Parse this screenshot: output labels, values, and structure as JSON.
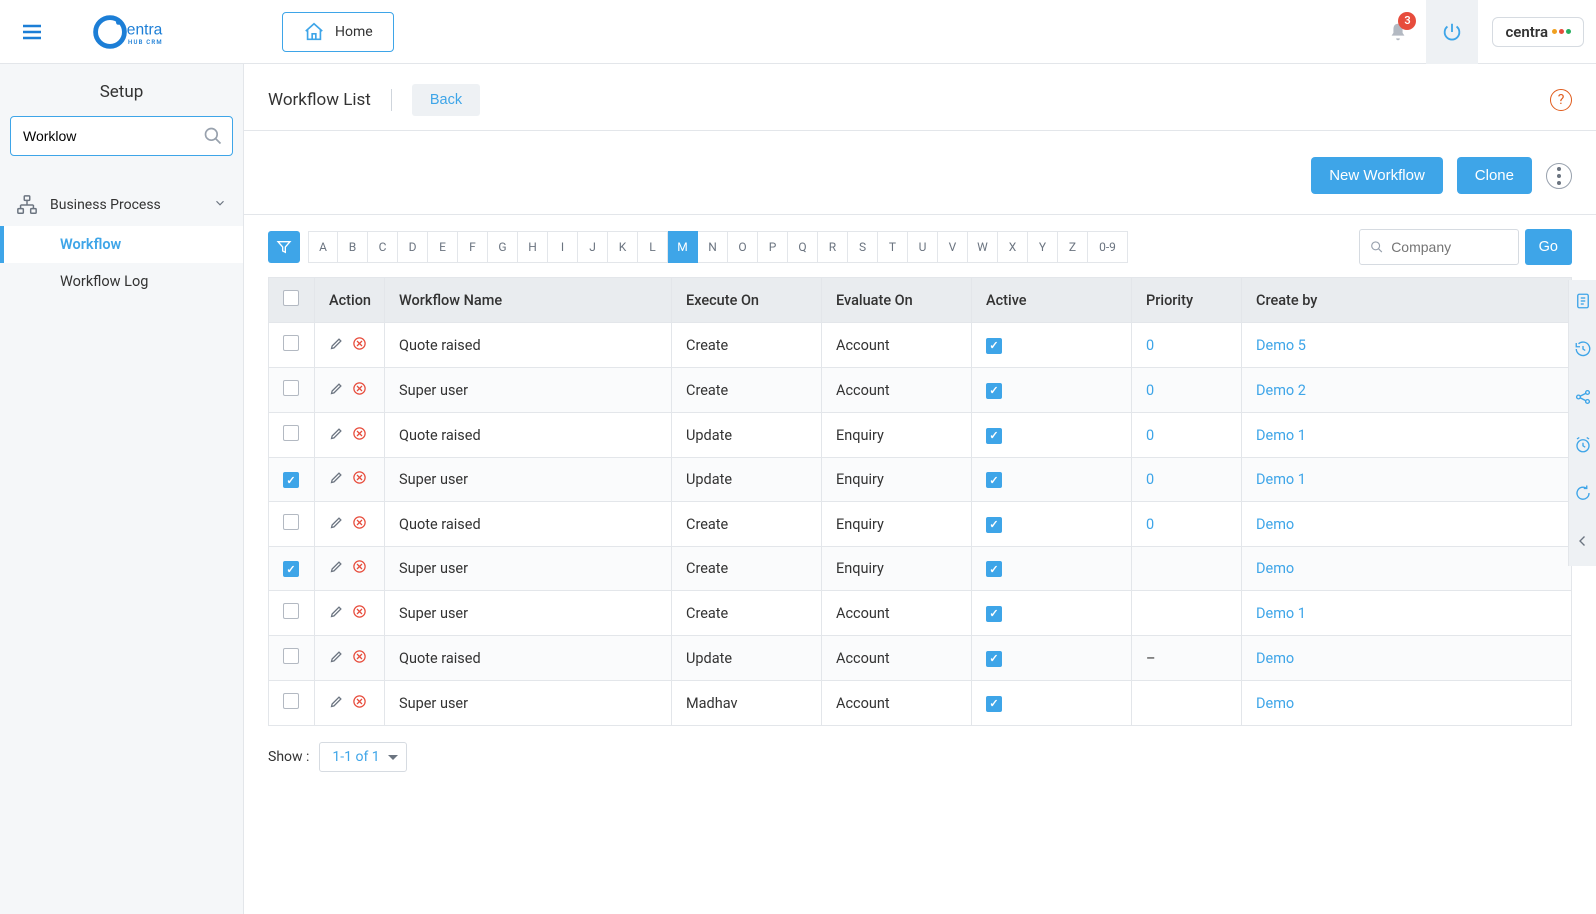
{
  "header": {
    "home_label": "Home",
    "notification_count": "3",
    "brand_label": "centra"
  },
  "sidebar": {
    "title": "Setup",
    "search_value": "Worklow",
    "group_label": "Business Process",
    "items": [
      {
        "label": "Workflow",
        "active": true
      },
      {
        "label": "Workflow Log",
        "active": false
      }
    ]
  },
  "page": {
    "title": "Workflow List",
    "back_label": "Back",
    "new_workflow_label": "New Workflow",
    "clone_label": "Clone"
  },
  "alpha": {
    "letters": [
      "A",
      "B",
      "C",
      "D",
      "E",
      "F",
      "G",
      "H",
      "I",
      "J",
      "K",
      "L",
      "M",
      "N",
      "O",
      "P",
      "Q",
      "R",
      "S",
      "T",
      "U",
      "V",
      "W",
      "X",
      "Y",
      "Z",
      "0-9"
    ],
    "active": "M"
  },
  "company_search": {
    "placeholder": "Company",
    "go_label": "Go"
  },
  "table": {
    "headers": {
      "action": "Action",
      "workflow_name": "Workflow Name",
      "execute_on": "Execute On",
      "evaluate_on": "Evaluate On",
      "active": "Active",
      "priority": "Priority",
      "create_by": "Create by"
    },
    "rows": [
      {
        "checked": false,
        "name": "Quote raised",
        "execute": "Create",
        "evaluate": "Account",
        "active": true,
        "priority": "0",
        "create_by": "Demo 5"
      },
      {
        "checked": false,
        "name": "Super user",
        "execute": "Create",
        "evaluate": "Account",
        "active": true,
        "priority": "0",
        "create_by": "Demo 2"
      },
      {
        "checked": false,
        "name": "Quote raised",
        "execute": "Update",
        "evaluate": "Enquiry",
        "active": true,
        "priority": "0",
        "create_by": "Demo 1"
      },
      {
        "checked": true,
        "name": "Super user",
        "execute": "Update",
        "evaluate": "Enquiry",
        "active": true,
        "priority": "0",
        "create_by": "Demo 1"
      },
      {
        "checked": false,
        "name": "Quote raised",
        "execute": "Create",
        "evaluate": "Enquiry",
        "active": true,
        "priority": "0",
        "create_by": "Demo"
      },
      {
        "checked": true,
        "name": "Super user",
        "execute": "Create",
        "evaluate": "Enquiry",
        "active": true,
        "priority": "",
        "create_by": "Demo"
      },
      {
        "checked": false,
        "name": "Super user",
        "execute": "Create",
        "evaluate": "Account",
        "active": true,
        "priority": "",
        "create_by": "Demo 1"
      },
      {
        "checked": false,
        "name": "Quote raised",
        "execute": "Update",
        "evaluate": "Account",
        "active": true,
        "priority": "–",
        "create_by": "Demo"
      },
      {
        "checked": false,
        "name": "Super user",
        "execute": "Madhav",
        "evaluate": "Account",
        "active": true,
        "priority": "",
        "create_by": "Demo"
      }
    ]
  },
  "pager": {
    "show_label": "Show :",
    "value": "1-1 of 1"
  },
  "colors": {
    "accent": "#3ea5e8",
    "badge": "#e74c3c",
    "help": "#e05a1a"
  }
}
